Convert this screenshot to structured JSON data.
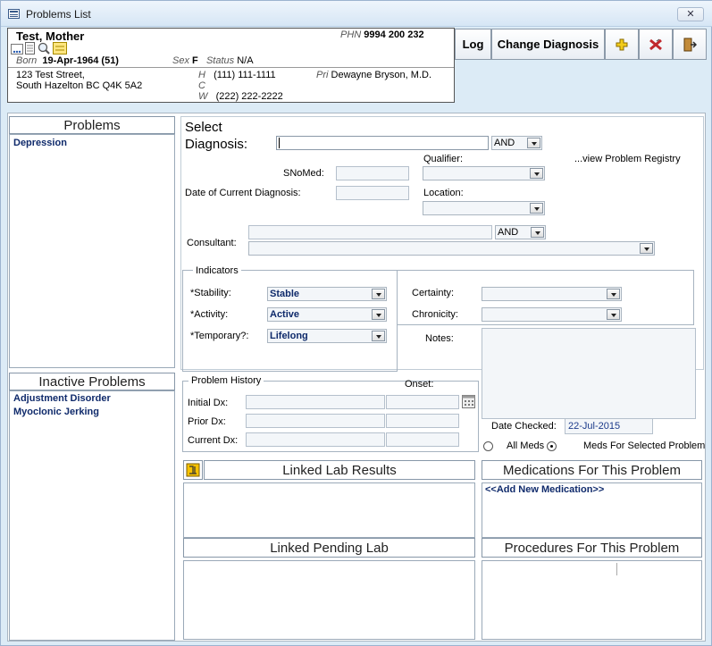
{
  "window": {
    "title": "Problems List",
    "close_label": "✕"
  },
  "patient": {
    "name": "Test, Mother",
    "phn_label": "PHN",
    "phn": "9994 200 232",
    "born_label": "Born",
    "born": "19-Apr-1964 (51)",
    "sex_label": "Sex",
    "sex": "F",
    "status_label": "Status",
    "status": "N/A",
    "address_line1": "123 Test Street,",
    "address_line2": "South Hazelton BC  Q4K 5A2",
    "phone_h_label": "H",
    "phone_h": "(111) 111-1111",
    "phone_c_label": "C",
    "phone_c": "",
    "phone_w_label": "W",
    "phone_w": "(222) 222-2222",
    "pri_label": "Pri",
    "pri": "Dewayne Bryson, M.D."
  },
  "toolbar": {
    "log": "Log",
    "change_diagnosis": "Change Diagnosis"
  },
  "problems": {
    "title": "Problems",
    "items": [
      "Depression"
    ]
  },
  "inactive": {
    "title": "Inactive Problems",
    "items": [
      "Adjustment Disorder",
      "Myoclonic Jerking"
    ]
  },
  "form": {
    "select_label": "Select",
    "diagnosis_label": "Diagnosis:",
    "diagnosis_value": "",
    "and1": "AND",
    "qualifier_label": "Qualifier:",
    "view_registry": "...view Problem Registry",
    "snomed_label": "SNoMed:",
    "date_current_label": "Date of Current Diagnosis:",
    "location_label": "Location:",
    "and2": "AND",
    "consultant_label": "Consultant:"
  },
  "indicators": {
    "title": "Indicators",
    "stability_label": "*Stability:",
    "stability": "Stable",
    "activity_label": "*Activity:",
    "activity": "Active",
    "temporary_label": "*Temporary?:",
    "temporary": "Lifelong",
    "certainty_label": "Certainty:",
    "chronicity_label": "Chronicity:"
  },
  "notes_label": "Notes:",
  "history": {
    "title": "Problem History",
    "onset_label": "Onset:",
    "initial_label": "Initial Dx:",
    "prior_label": "Prior Dx:",
    "current_label": "Current Dx:"
  },
  "date_checked_label": "Date Checked:",
  "date_checked": "22-Jul-2015",
  "meds_filter": {
    "all": "All Meds",
    "selected": "Meds For Selected Problem"
  },
  "sections": {
    "linked_lab": "Linked Lab Results",
    "meds_problem": "Medications For This Problem",
    "add_med": "<<Add New Medication>>",
    "pending_lab": "Linked Pending Lab",
    "procedures": "Procedures For This Problem"
  },
  "colors": {
    "accent_text": "#0f2a6b",
    "window_bg": "#dcebf6",
    "add_icon": "#e0b400",
    "delete_icon": "#c0282d"
  }
}
